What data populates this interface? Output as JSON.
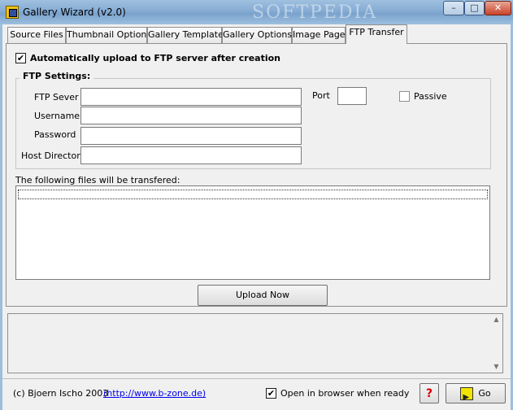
{
  "window": {
    "title": "Gallery Wizard (v2.0)",
    "watermark": "SOFTPEDIA",
    "minimize_glyph": "–",
    "maximize_glyph": "□",
    "close_glyph": "✕"
  },
  "tabs": [
    {
      "label": "Source Files",
      "active": false
    },
    {
      "label": "Thumbnail Options",
      "active": false
    },
    {
      "label": "Gallery Template",
      "active": false
    },
    {
      "label": "Gallery Options",
      "active": false
    },
    {
      "label": "Image Page",
      "active": false
    },
    {
      "label": "FTP Transfer",
      "active": true
    }
  ],
  "ftp_tab": {
    "auto_upload_label": "Automatically upload to FTP server after creation",
    "auto_upload_checked": "✔",
    "group_title": "FTP Settings:",
    "fields": {
      "server_label": "FTP Sever",
      "server_value": "",
      "username_label": "Username",
      "username_value": "",
      "password_label": "Password",
      "password_value": "",
      "host_dir_label": "Host Directory",
      "host_dir_value": "",
      "port_label": "Port",
      "port_value": "",
      "passive_label": "Passive",
      "passive_checked": ""
    },
    "files_label": "The following files will be transfered:",
    "files": [],
    "upload_button": "Upload Now"
  },
  "footer": {
    "copyright": "(c) Bjoern Ischo 2003",
    "link_text": "(http://www.b-zone.de)",
    "open_browser_label": "Open in browser when ready",
    "open_browser_checked": "✔",
    "help_glyph": "?",
    "go_label": "Go"
  },
  "colors": {
    "titlebar": "#86acd4",
    "link": "#0000ee",
    "background": "#f0f0f0"
  }
}
